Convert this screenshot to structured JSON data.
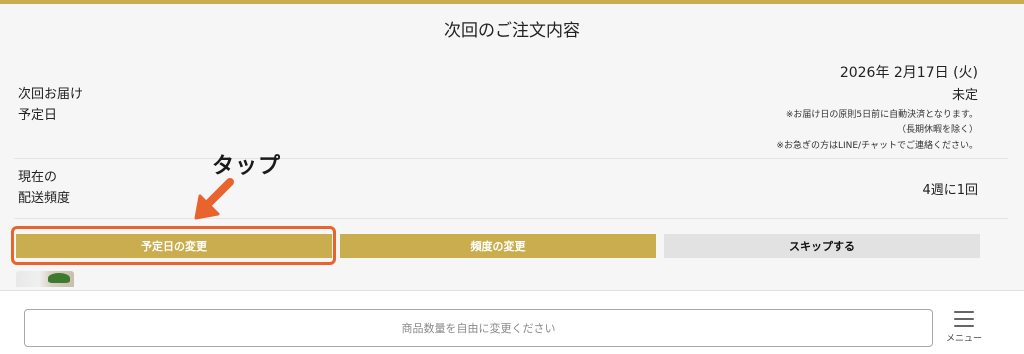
{
  "page": {
    "title": "次回のご注文内容"
  },
  "delivery": {
    "label_line1": "次回お届け",
    "label_line2": "予定日",
    "date": "2026年 2月17日 (火)",
    "status": "未定",
    "note1": "※お届け日の原則5日前に自動決済となります。",
    "note2": "（長期休暇を除く）",
    "note3": "※お急ぎの方はLINE/チャットでご連絡ください。"
  },
  "frequency": {
    "label_line1": "現在の",
    "label_line2": "配送頻度",
    "value": "4週に1回"
  },
  "annotation": {
    "text": "タップ"
  },
  "buttons": {
    "change_date": "予定日の変更",
    "change_frequency": "頻度の変更",
    "skip": "スキップする"
  },
  "search": {
    "placeholder": "商品数量を自由に変更ください"
  },
  "menu": {
    "label": "メニュー"
  },
  "colors": {
    "accent_gold": "#c9ad4f",
    "highlight_orange": "#e8642c",
    "skip_gray": "#e2e2e2"
  },
  "icons": {
    "arrow": "arrow-down-left-icon",
    "menu": "hamburger-menu-icon"
  }
}
